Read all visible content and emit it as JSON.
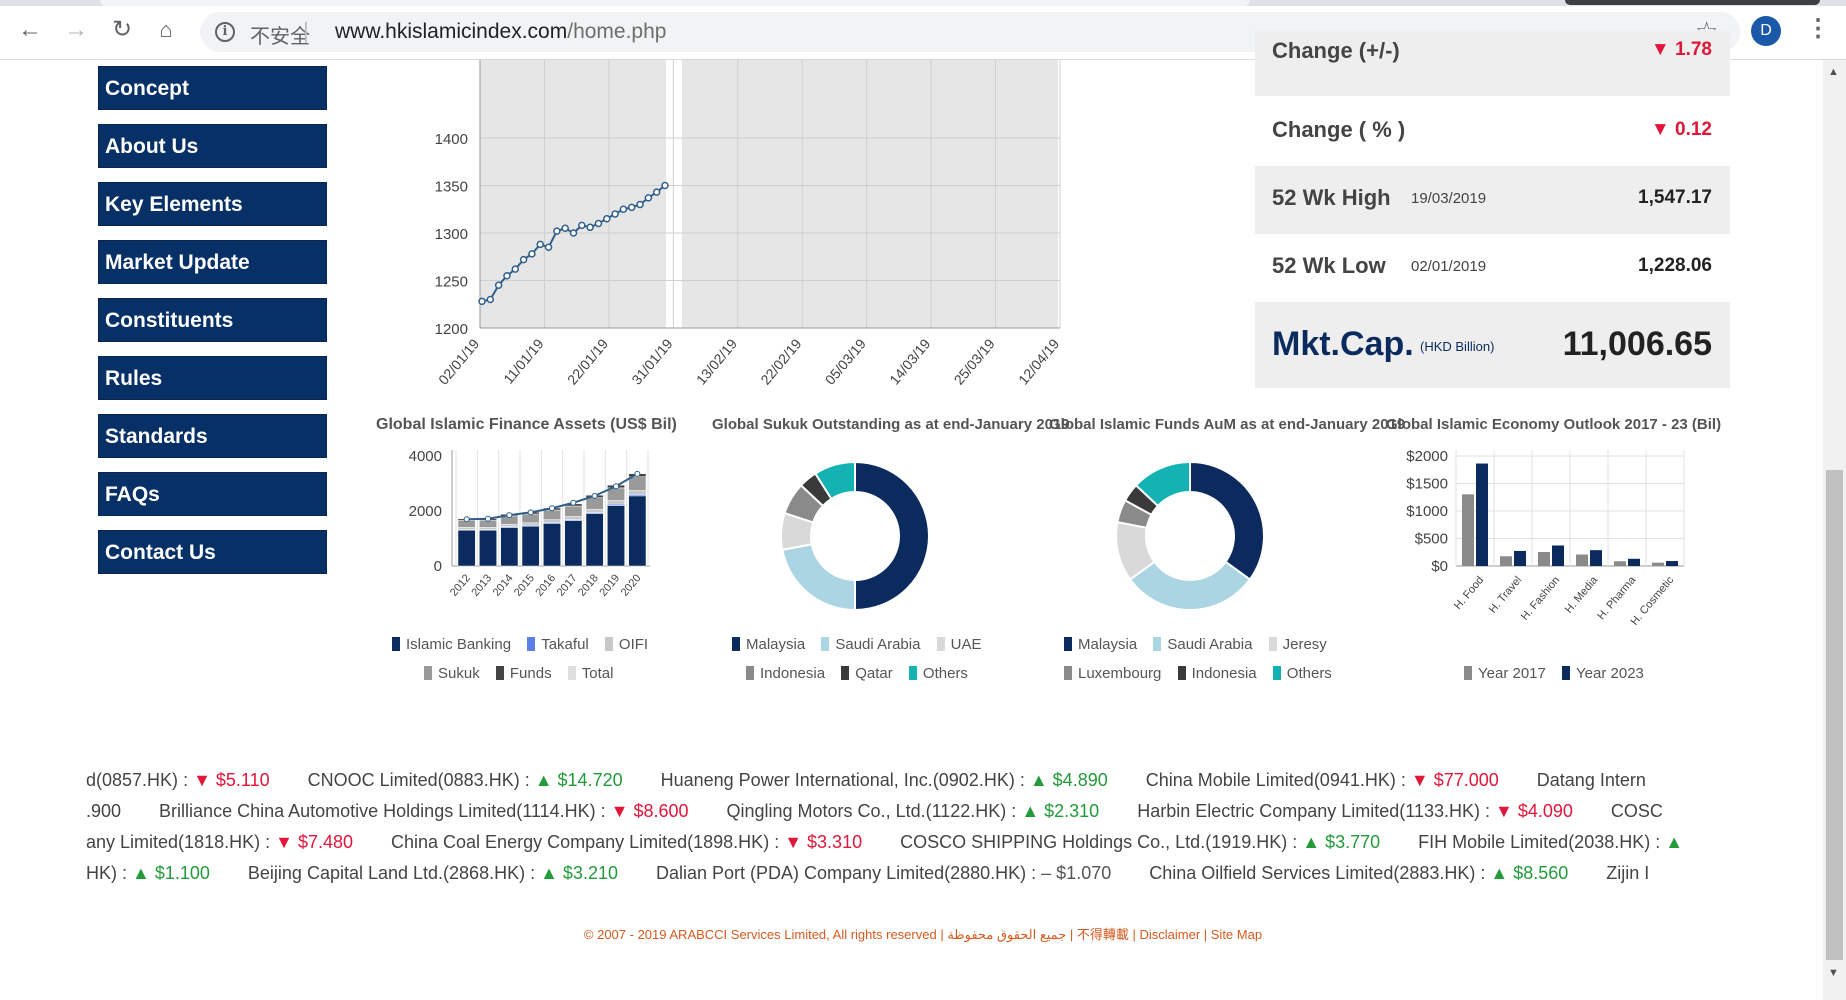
{
  "browser": {
    "insecure_label": "不安全",
    "url_host": "www.hkislamicindex.com",
    "url_path": "/home.php",
    "avatar_letter": "D"
  },
  "sidebar": {
    "items": [
      {
        "label": "Concept"
      },
      {
        "label": "About Us"
      },
      {
        "label": "Key Elements"
      },
      {
        "label": "Market Update"
      },
      {
        "label": "Constituents"
      },
      {
        "label": "Rules"
      },
      {
        "label": "Standards"
      },
      {
        "label": "FAQs"
      },
      {
        "label": "Contact Us"
      }
    ]
  },
  "index_panel": {
    "change_abs_label": "Change (+/-)",
    "change_abs_value": "1.78",
    "change_pct_label": "Change ( % )",
    "change_pct_value": "0.12",
    "high_label": "52 Wk High",
    "high_date": "19/03/2019",
    "high_value": "1,547.17",
    "low_label": "52 Wk Low",
    "low_date": "02/01/2019",
    "low_value": "1,228.06",
    "mktcap_label": "Mkt.Cap.",
    "mktcap_unit": "(HKD Billion)",
    "mktcap_value": "11,006.65",
    "colors": {
      "down": "#e0163a",
      "up": "#239b3b"
    }
  },
  "chart_data": [
    {
      "type": "line",
      "title": "",
      "y_ticks": [
        "1200",
        "1250",
        "1300",
        "1350",
        "1400"
      ],
      "ylim": [
        1200,
        1440
      ],
      "x_ticks": [
        "02/01/19",
        "11/01/19",
        "22/01/19",
        "31/01/19",
        "13/02/19",
        "22/02/19",
        "05/03/19",
        "14/03/19",
        "25/03/19",
        "12/04/19"
      ],
      "series": [
        {
          "values": [
            1228,
            1230,
            1245,
            1255,
            1262,
            1272,
            1278,
            1288,
            1285,
            1302,
            1305,
            1300,
            1308,
            1306,
            1310,
            1315,
            1320,
            1325,
            1327,
            1330,
            1337,
            1343,
            1350
          ]
        }
      ]
    },
    {
      "type": "bar",
      "title": "Global Islamic Finance Assets (US$ Bil)",
      "categories": [
        "2012",
        "2013",
        "2014",
        "2015",
        "2016",
        "2017",
        "2018",
        "2019",
        "2020"
      ],
      "y_ticks": [
        "0",
        "2000",
        "4000"
      ],
      "ylim": [
        0,
        4000
      ],
      "series": [
        {
          "name": "Islamic Banking",
          "values": [
            1300,
            1300,
            1400,
            1450,
            1550,
            1650,
            1900,
            2200,
            2550
          ]
        },
        {
          "name": "Takaful",
          "values": [
            25,
            25,
            30,
            30,
            35,
            40,
            45,
            50,
            55
          ]
        },
        {
          "name": "OIFI",
          "values": [
            80,
            80,
            90,
            90,
            100,
            110,
            120,
            130,
            140
          ]
        },
        {
          "name": "Sukuk",
          "values": [
            250,
            250,
            300,
            320,
            350,
            380,
            420,
            460,
            500
          ]
        },
        {
          "name": "Funds",
          "values": [
            60,
            60,
            65,
            70,
            75,
            80,
            90,
            100,
            110
          ]
        },
        {
          "name": "Total",
          "values": [
            1700,
            1720,
            1850,
            1950,
            2100,
            2300,
            2550,
            2900,
            3350
          ]
        }
      ],
      "colors": {
        "Islamic Banking": "#0b2b5e",
        "Takaful": "#5b7fe6",
        "OIFI": "#c8c8c8",
        "Sukuk": "#9a9a9a",
        "Funds": "#444444",
        "Total": "#dedede"
      }
    },
    {
      "type": "pie",
      "title": "Global Sukuk Outstanding as at end-January 2019",
      "labels": [
        "Malaysia",
        "Saudi Arabia",
        "UAE",
        "Indonesia",
        "Qatar",
        "Others"
      ],
      "values": [
        50,
        22,
        8,
        7,
        4,
        9
      ],
      "colors": [
        "#0b2b5e",
        "#acd5e3",
        "#d9d9d9",
        "#8a8a8a",
        "#3a3a3a",
        "#14b2b2"
      ]
    },
    {
      "type": "pie",
      "title": "Global Islamic Funds AuM as at end-January 2019",
      "labels": [
        "Malaysia",
        "Saudi Arabia",
        "Jeresy",
        "Luxembourg",
        "Indonesia",
        "Others"
      ],
      "values": [
        35,
        30,
        13,
        5,
        4,
        13
      ],
      "colors": [
        "#0b2b5e",
        "#acd5e3",
        "#d9d9d9",
        "#8a8a8a",
        "#3a3a3a",
        "#14b2b2"
      ]
    },
    {
      "type": "bar",
      "title": "Global Islamic Economy Outlook 2017 - 23 (Bil)",
      "categories": [
        "H. Food",
        "H. Travel",
        "H. Fashion",
        "H. Media",
        "H. Pharma",
        "H. Cosmetic"
      ],
      "y_ticks": [
        "$0",
        "$500",
        "$1000",
        "$1500",
        "$2000"
      ],
      "ylim": [
        0,
        2000
      ],
      "series": [
        {
          "name": "Year 2017",
          "values": [
            1303,
            177,
            254,
            209,
            87,
            61
          ]
        },
        {
          "name": "Year 2023",
          "values": [
            1863,
            274,
            373,
            288,
            131,
            90
          ]
        }
      ],
      "colors": {
        "Year 2017": "#8a8a8a",
        "Year 2023": "#0b2b5e"
      }
    }
  ],
  "ticker": {
    "rows": [
      [
        {
          "name": "d(0857.HK)",
          "dir": "down",
          "price": "$5.110"
        },
        {
          "name": "CNOOC Limited(0883.HK)",
          "dir": "up",
          "price": "$14.720"
        },
        {
          "name": "Huaneng Power International, Inc.(0902.HK)",
          "dir": "up",
          "price": "$4.890"
        },
        {
          "name": "China Mobile Limited(0941.HK)",
          "dir": "down",
          "price": "$77.000"
        },
        {
          "name": "Datang Intern",
          "dir": "",
          "price": ""
        }
      ],
      [
        {
          "name": ".900",
          "dir": "",
          "price": ""
        },
        {
          "name": "Brilliance China Automotive Holdings Limited(1114.HK)",
          "dir": "down",
          "price": "$8.600"
        },
        {
          "name": "Qingling Motors Co., Ltd.(1122.HK)",
          "dir": "up",
          "price": "$2.310"
        },
        {
          "name": "Harbin Electric Company Limited(1133.HK)",
          "dir": "down",
          "price": "$4.090"
        },
        {
          "name": "COSC",
          "dir": "",
          "price": ""
        }
      ],
      [
        {
          "name": "any Limited(1818.HK)",
          "dir": "down",
          "price": "$7.480"
        },
        {
          "name": "China Coal Energy Company Limited(1898.HK)",
          "dir": "down",
          "price": "$3.310"
        },
        {
          "name": "COSCO SHIPPING Holdings Co., Ltd.(1919.HK)",
          "dir": "up",
          "price": "$3.770"
        },
        {
          "name": "FIH Mobile Limited(2038.HK)",
          "dir": "up",
          "price": ""
        }
      ],
      [
        {
          "name": "HK)",
          "dir": "up",
          "price": "$1.100"
        },
        {
          "name": "Beijing Capital Land Ltd.(2868.HK)",
          "dir": "up",
          "price": "$3.210"
        },
        {
          "name": "Dalian Port (PDA) Company Limited(2880.HK)",
          "dir": "flat",
          "price": "$1.070"
        },
        {
          "name": "China Oilfield Services Limited(2883.HK)",
          "dir": "up",
          "price": "$8.560"
        },
        {
          "name": "Zijin I",
          "dir": "",
          "price": ""
        }
      ]
    ]
  },
  "footer": {
    "copyright": "© 2007 - 2019 ARABCCI Services Limited, All rights reserved",
    "arabic": "جميع الحقوق محفوظة",
    "chinese": "不得轉載",
    "disclaimer": "Disclaimer",
    "sitemap": "Site Map"
  }
}
